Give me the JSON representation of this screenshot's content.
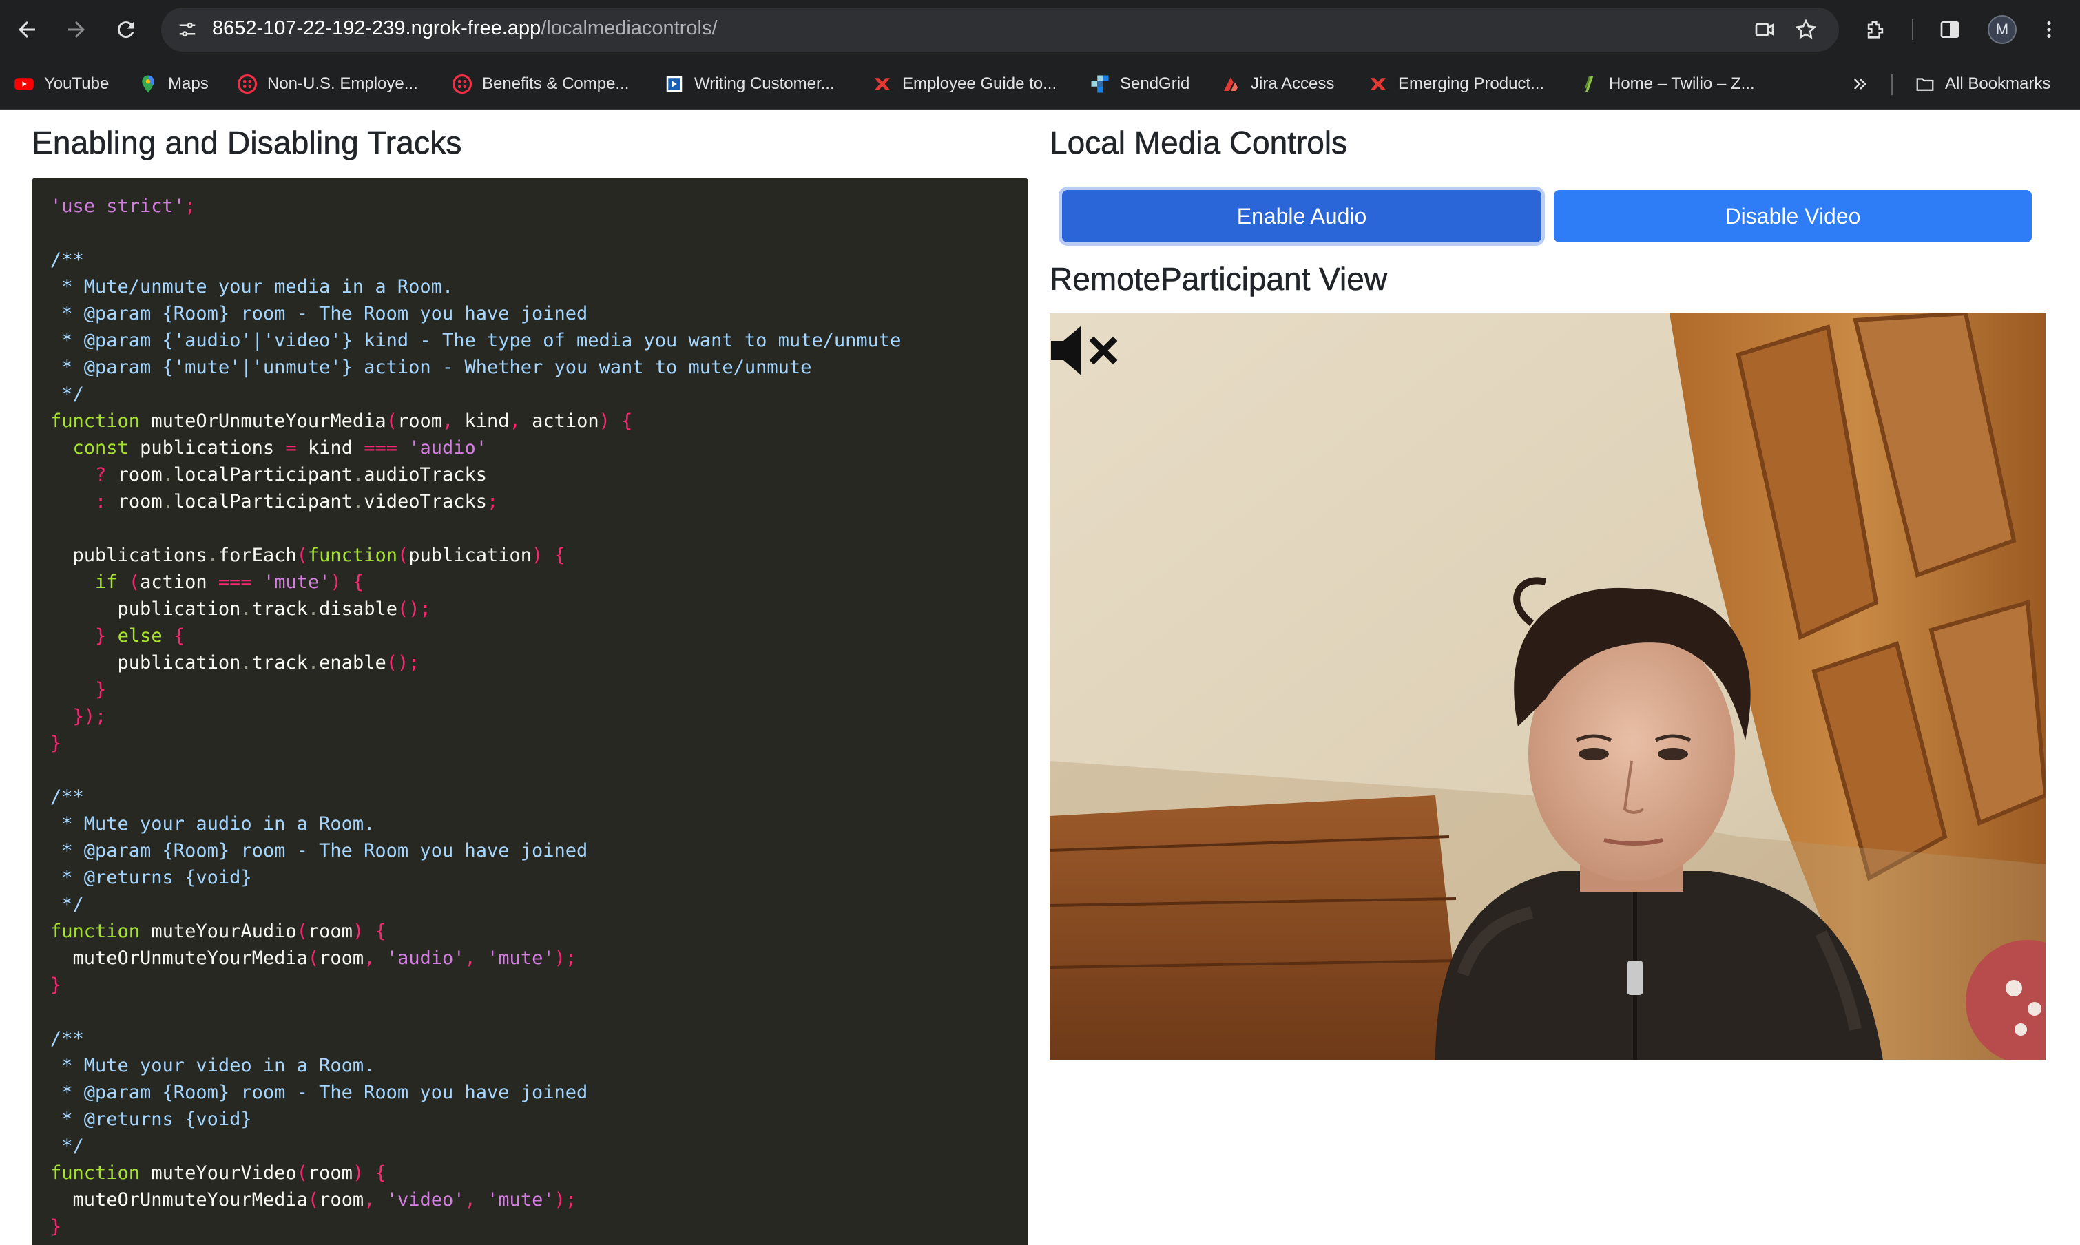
{
  "browser": {
    "url_host": "8652-107-22-192-239.ngrok-free.app",
    "url_path": "/localmediacontrols/",
    "profile_initial": "M",
    "bookmarks": [
      {
        "label": "YouTube",
        "icon": "youtube-icon"
      },
      {
        "label": "Maps",
        "icon": "maps-icon"
      },
      {
        "label": "Non-U.S. Employe...",
        "icon": "twilio-icon"
      },
      {
        "label": "Benefits & Compe...",
        "icon": "twilio-icon"
      },
      {
        "label": "Writing Customer...",
        "icon": "doc-icon"
      },
      {
        "label": "Employee Guide to...",
        "icon": "red-x-icon"
      },
      {
        "label": "SendGrid",
        "icon": "sendgrid-icon"
      },
      {
        "label": "Jira Access",
        "icon": "jira-icon"
      },
      {
        "label": "Emerging Product...",
        "icon": "red-x-icon"
      },
      {
        "label": "Home – Twilio – Z...",
        "icon": "leaf-icon"
      }
    ],
    "all_bookmarks_label": "All Bookmarks"
  },
  "left": {
    "title": "Enabling and Disabling Tracks",
    "code_lines": [
      "'use strict';",
      "",
      "/**",
      " * Mute/unmute your media in a Room.",
      " * @param {Room} room - The Room you have joined",
      " * @param {'audio'|'video'} kind - The type of media you want to mute/unmute",
      " * @param {'mute'|'unmute'} action - Whether you want to mute/unmute",
      " */",
      "function muteOrUnmuteYourMedia(room, kind, action) {",
      "  const publications = kind === 'audio'",
      "    ? room.localParticipant.audioTracks",
      "    : room.localParticipant.videoTracks;",
      "",
      "  publications.forEach(function(publication) {",
      "    if (action === 'mute') {",
      "      publication.track.disable();",
      "    } else {",
      "      publication.track.enable();",
      "    }",
      "  });",
      "}",
      "",
      "/**",
      " * Mute your audio in a Room.",
      " * @param {Room} room - The Room you have joined",
      " * @returns {void}",
      " */",
      "function muteYourAudio(room) {",
      "  muteOrUnmuteYourMedia(room, 'audio', 'mute');",
      "}",
      "",
      "/**",
      " * Mute your video in a Room.",
      " * @param {Room} room - The Room you have joined",
      " * @returns {void}",
      " */",
      "function muteYourVideo(room) {",
      "  muteOrUnmuteYourMedia(room, 'video', 'mute');",
      "}"
    ]
  },
  "right": {
    "controls_title": "Local Media Controls",
    "enable_audio_label": "Enable Audio",
    "disable_video_label": "Disable Video",
    "remote_title": "RemoteParticipant View",
    "mute_indicator_icon": "speaker-muted-icon"
  },
  "colors": {
    "button_primary": "#2e7cf6",
    "code_background": "#272822"
  }
}
